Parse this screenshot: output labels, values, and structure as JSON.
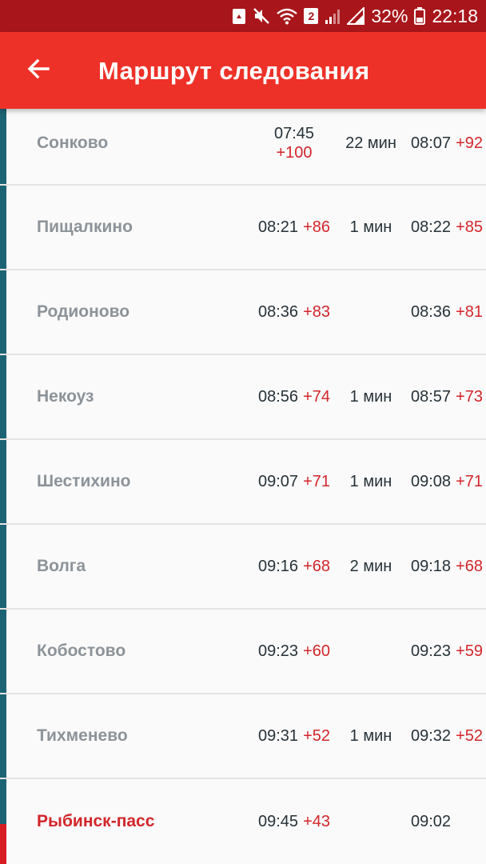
{
  "status_bar": {
    "battery_percent": "32%",
    "time": "22:18",
    "wifi_badge": "2",
    "icons": [
      "recycle-icon",
      "mute-icon",
      "wifi-icon",
      "signal-icon",
      "no-signal-icon",
      "battery-icon"
    ]
  },
  "app_bar": {
    "title": "Маршрут следования",
    "back_icon": "arrow-left-icon"
  },
  "colors": {
    "status_bar": "#a8161b",
    "app_bar": "#ee3128",
    "route_bar": "#1c6475",
    "current_bar": "#d71c22",
    "delay": "#d2262b",
    "station_text": "#8c9399",
    "time_text": "#263238"
  },
  "stations": [
    {
      "name": "Сонково",
      "arrival": "07:45",
      "arrival_delay": "+100",
      "stop": "22 мин",
      "departure": "08:07",
      "departure_delay": "+92"
    },
    {
      "name": "Пищалкино",
      "arrival": "08:21",
      "arrival_delay": "+86",
      "stop": "1 мин",
      "departure": "08:22",
      "departure_delay": "+85"
    },
    {
      "name": "Родионово",
      "arrival": "08:36",
      "arrival_delay": "+83",
      "stop": "",
      "departure": "08:36",
      "departure_delay": "+81"
    },
    {
      "name": "Некоуз",
      "arrival": "08:56",
      "arrival_delay": "+74",
      "stop": "1 мин",
      "departure": "08:57",
      "departure_delay": "+73"
    },
    {
      "name": "Шестихино",
      "arrival": "09:07",
      "arrival_delay": "+71",
      "stop": "1 мин",
      "departure": "09:08",
      "departure_delay": "+71"
    },
    {
      "name": "Волга",
      "arrival": "09:16",
      "arrival_delay": "+68",
      "stop": "2 мин",
      "departure": "09:18",
      "departure_delay": "+68"
    },
    {
      "name": "Кобостово",
      "arrival": "09:23",
      "arrival_delay": "+60",
      "stop": "",
      "departure": "09:23",
      "departure_delay": "+59"
    },
    {
      "name": "Тихменево",
      "arrival": "09:31",
      "arrival_delay": "+52",
      "stop": "1 мин",
      "departure": "09:32",
      "departure_delay": "+52"
    },
    {
      "name": "Рыбинск-пасс",
      "arrival": "09:45",
      "arrival_delay": "+43",
      "stop": "",
      "departure": "09:02",
      "departure_delay": ""
    }
  ]
}
